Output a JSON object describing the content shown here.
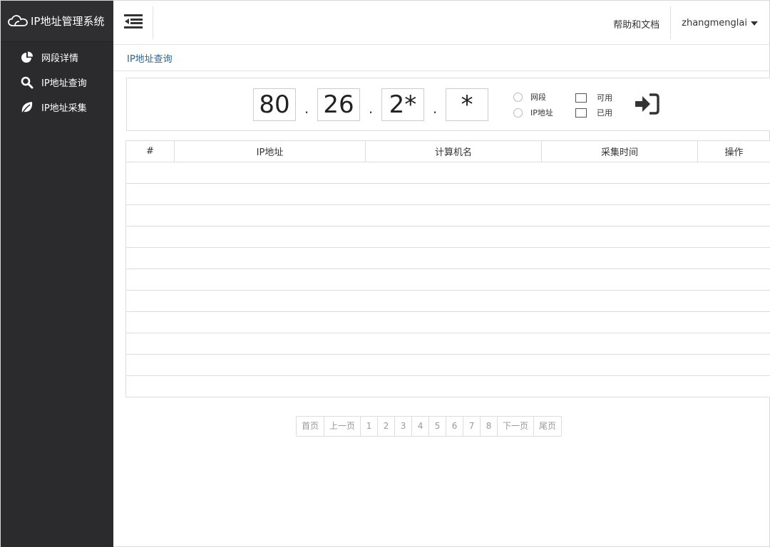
{
  "app": {
    "title": "IP地址管理系统"
  },
  "sidebar": {
    "items": [
      {
        "label": "网段详情",
        "icon": "pie-chart-icon"
      },
      {
        "label": "IP地址查询",
        "icon": "search-icon"
      },
      {
        "label": "IP地址采集",
        "icon": "leaf-icon"
      }
    ]
  },
  "header": {
    "help_label": "帮助和文档",
    "username": "zhangmenglai"
  },
  "breadcrumb": {
    "current": "IP地址查询"
  },
  "search": {
    "octets": [
      "80",
      "26",
      "2*",
      "*"
    ],
    "radio_options": [
      "网段",
      "IP地址"
    ],
    "checkbox_options": [
      "可用",
      "已用"
    ]
  },
  "table": {
    "columns": [
      "#",
      "IP地址",
      "计算机名",
      "采集时间",
      "操作"
    ],
    "empty_rows": 11
  },
  "pagination": {
    "first": "首页",
    "prev": "上一页",
    "pages": [
      "1",
      "2",
      "3",
      "4",
      "5",
      "6",
      "7",
      "8"
    ],
    "next": "下一页",
    "last": "尾页"
  },
  "colors": {
    "sidebar_bg": "#2b2a2c",
    "link": "#2a6496",
    "border": "#dddddd"
  }
}
